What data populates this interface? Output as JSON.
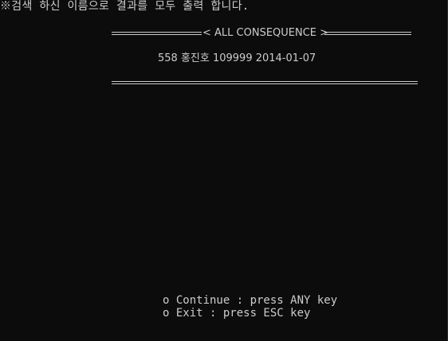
{
  "console": {
    "prompt": "※검색 하신 이름으로 결과를 모두 출력 합니다.",
    "header_title": "< ALL CONSEQUENCE >",
    "result_rows": [
      {
        "text": "558 홍진호 109999 2014-01-07"
      }
    ],
    "menu": {
      "continue": "o Continue : press ANY key",
      "exit": "o Exit : press ESC key"
    }
  },
  "colors": {
    "background": "#0c0c0c",
    "foreground": "#cccccc"
  }
}
